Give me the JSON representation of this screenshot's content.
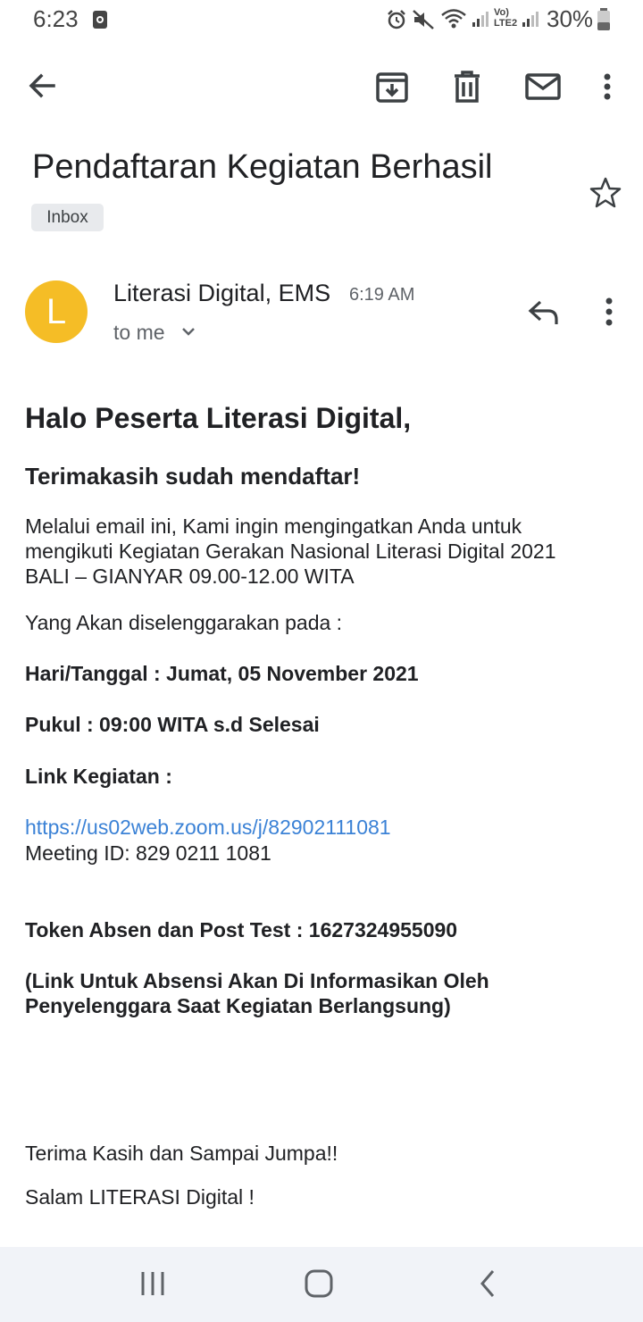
{
  "status_bar": {
    "time": "6:23",
    "battery": "30%",
    "network_label": "Vo) LTE2"
  },
  "toolbar": {
    "back_icon": "arrow-left-icon",
    "archive_icon": "archive-icon",
    "delete_icon": "trash-icon",
    "mark_unread_icon": "mail-icon",
    "more_icon": "more-vert-icon"
  },
  "email": {
    "subject": "Pendaftaran Kegiatan Berhasil",
    "label": "Inbox",
    "sender": {
      "avatar_letter": "L",
      "avatar_color": "#f5bd26",
      "name": "Literasi Digital, EMS",
      "time": "6:19 AM",
      "recipient": "to me"
    },
    "body": {
      "greeting": "Halo Peserta Literasi Digital,",
      "thanks": "Terimakasih sudah mendaftar!",
      "intro_lines": [
        "Melalui email ini, Kami ingin mengingatkan Anda untuk",
        "mengikuti Kegiatan Gerakan Nasional Literasi Digital 2021",
        "BALI – GIANYAR 09.00-12.00 WITA"
      ],
      "held_on": "Yang Akan diselenggarakan pada :",
      "date_line": "Hari/Tanggal : Jumat, 05 November 2021",
      "time_line": "Pukul : 09:00 WITA s.d Selesai",
      "link_heading": "Link Kegiatan :",
      "link_url": "https://us02web.zoom.us/j/82902111081",
      "meeting_id": "Meeting ID: 829 0211 1081",
      "token": "Token Absen dan Post Test : 1627324955090",
      "note_lines": [
        "(Link Untuk Absensi Akan Di Informasikan Oleh",
        "Penyelenggara Saat Kegiatan Berlangsung)"
      ],
      "closing": "Terima Kasih dan Sampai Jumpa!!",
      "signoff": "Salam LITERASI Digital !"
    }
  },
  "colors": {
    "accent_link": "#3b82d6",
    "chip_bg": "#e8eaed",
    "nav_bg": "#f1f3f8"
  },
  "nav_bar": {
    "recents_icon": "recents-icon",
    "home_icon": "home-icon",
    "back_icon": "nav-back-icon"
  }
}
